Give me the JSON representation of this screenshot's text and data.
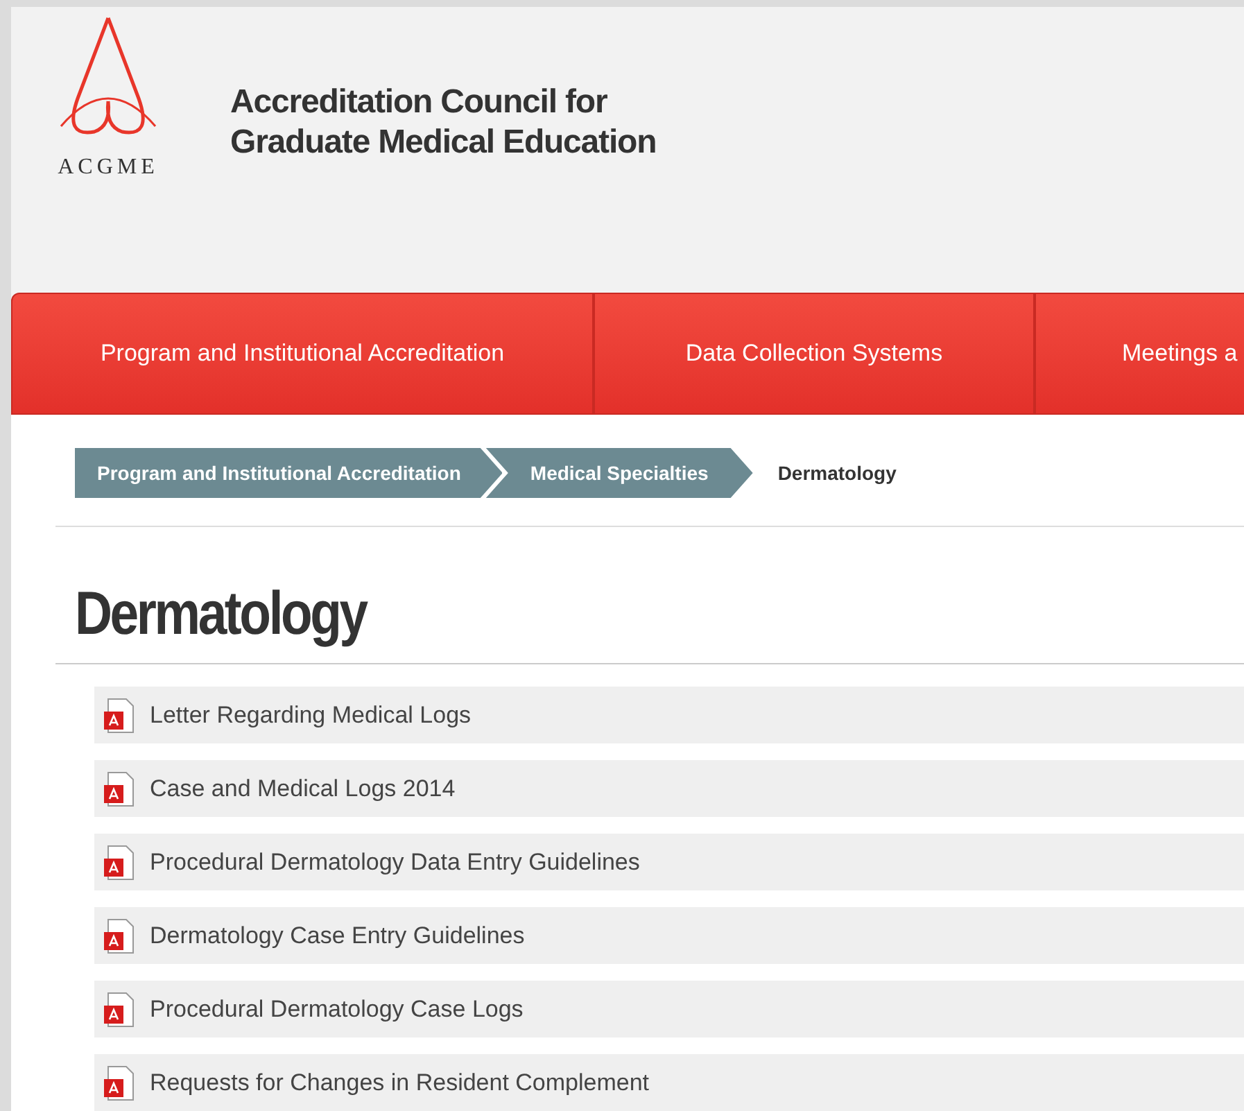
{
  "logo": {
    "wordmark": "ACGME",
    "name_line_1": "Accreditation Council for",
    "name_line_2": "Graduate Medical Education"
  },
  "nav": [
    {
      "label": "Program and Institutional Accreditation"
    },
    {
      "label": "Data Collection Systems"
    },
    {
      "label": "Meetings a"
    }
  ],
  "breadcrumb": [
    {
      "label": "Program and Institutional Accreditation",
      "current": false
    },
    {
      "label": "Medical Specialties",
      "current": false
    },
    {
      "label": "Dermatology",
      "current": true
    }
  ],
  "heading": "Dermatology",
  "documents": [
    {
      "title": "Letter Regarding Medical Logs"
    },
    {
      "title": "Case and Medical Logs 2014"
    },
    {
      "title": "Procedural Dermatology Data Entry Guidelines"
    },
    {
      "title": "Dermatology Case Entry Guidelines"
    },
    {
      "title": "Procedural Dermatology Case Logs"
    },
    {
      "title": "Requests for Changes in Resident Complement"
    }
  ]
}
